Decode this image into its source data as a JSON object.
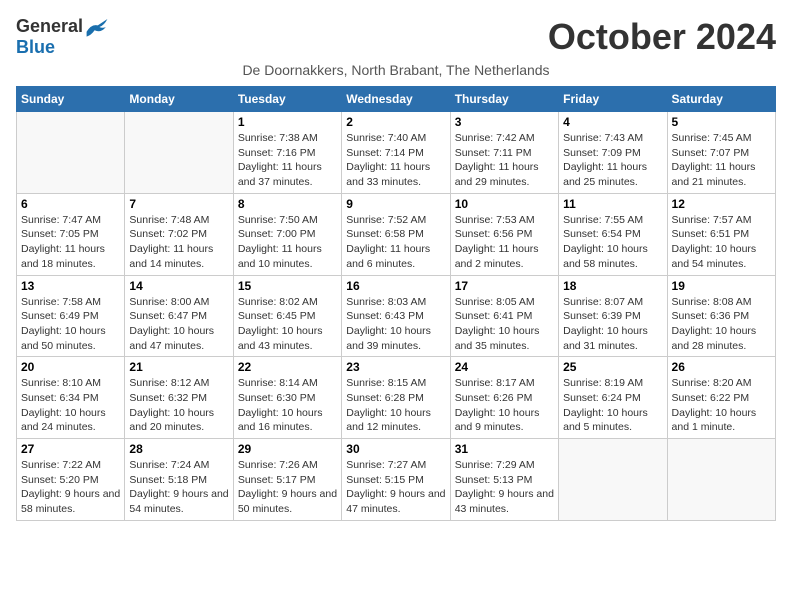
{
  "header": {
    "logo_general": "General",
    "logo_blue": "Blue",
    "month": "October 2024",
    "subtitle": "De Doornakkers, North Brabant, The Netherlands"
  },
  "days_of_week": [
    "Sunday",
    "Monday",
    "Tuesday",
    "Wednesday",
    "Thursday",
    "Friday",
    "Saturday"
  ],
  "weeks": [
    [
      {
        "day": "",
        "empty": true
      },
      {
        "day": "",
        "empty": true
      },
      {
        "day": "1",
        "sunrise": "7:38 AM",
        "sunset": "7:16 PM",
        "daylight": "11 hours and 37 minutes."
      },
      {
        "day": "2",
        "sunrise": "7:40 AM",
        "sunset": "7:14 PM",
        "daylight": "11 hours and 33 minutes."
      },
      {
        "day": "3",
        "sunrise": "7:42 AM",
        "sunset": "7:11 PM",
        "daylight": "11 hours and 29 minutes."
      },
      {
        "day": "4",
        "sunrise": "7:43 AM",
        "sunset": "7:09 PM",
        "daylight": "11 hours and 25 minutes."
      },
      {
        "day": "5",
        "sunrise": "7:45 AM",
        "sunset": "7:07 PM",
        "daylight": "11 hours and 21 minutes."
      }
    ],
    [
      {
        "day": "6",
        "sunrise": "7:47 AM",
        "sunset": "7:05 PM",
        "daylight": "11 hours and 18 minutes."
      },
      {
        "day": "7",
        "sunrise": "7:48 AM",
        "sunset": "7:02 PM",
        "daylight": "11 hours and 14 minutes."
      },
      {
        "day": "8",
        "sunrise": "7:50 AM",
        "sunset": "7:00 PM",
        "daylight": "11 hours and 10 minutes."
      },
      {
        "day": "9",
        "sunrise": "7:52 AM",
        "sunset": "6:58 PM",
        "daylight": "11 hours and 6 minutes."
      },
      {
        "day": "10",
        "sunrise": "7:53 AM",
        "sunset": "6:56 PM",
        "daylight": "11 hours and 2 minutes."
      },
      {
        "day": "11",
        "sunrise": "7:55 AM",
        "sunset": "6:54 PM",
        "daylight": "10 hours and 58 minutes."
      },
      {
        "day": "12",
        "sunrise": "7:57 AM",
        "sunset": "6:51 PM",
        "daylight": "10 hours and 54 minutes."
      }
    ],
    [
      {
        "day": "13",
        "sunrise": "7:58 AM",
        "sunset": "6:49 PM",
        "daylight": "10 hours and 50 minutes."
      },
      {
        "day": "14",
        "sunrise": "8:00 AM",
        "sunset": "6:47 PM",
        "daylight": "10 hours and 47 minutes."
      },
      {
        "day": "15",
        "sunrise": "8:02 AM",
        "sunset": "6:45 PM",
        "daylight": "10 hours and 43 minutes."
      },
      {
        "day": "16",
        "sunrise": "8:03 AM",
        "sunset": "6:43 PM",
        "daylight": "10 hours and 39 minutes."
      },
      {
        "day": "17",
        "sunrise": "8:05 AM",
        "sunset": "6:41 PM",
        "daylight": "10 hours and 35 minutes."
      },
      {
        "day": "18",
        "sunrise": "8:07 AM",
        "sunset": "6:39 PM",
        "daylight": "10 hours and 31 minutes."
      },
      {
        "day": "19",
        "sunrise": "8:08 AM",
        "sunset": "6:36 PM",
        "daylight": "10 hours and 28 minutes."
      }
    ],
    [
      {
        "day": "20",
        "sunrise": "8:10 AM",
        "sunset": "6:34 PM",
        "daylight": "10 hours and 24 minutes."
      },
      {
        "day": "21",
        "sunrise": "8:12 AM",
        "sunset": "6:32 PM",
        "daylight": "10 hours and 20 minutes."
      },
      {
        "day": "22",
        "sunrise": "8:14 AM",
        "sunset": "6:30 PM",
        "daylight": "10 hours and 16 minutes."
      },
      {
        "day": "23",
        "sunrise": "8:15 AM",
        "sunset": "6:28 PM",
        "daylight": "10 hours and 12 minutes."
      },
      {
        "day": "24",
        "sunrise": "8:17 AM",
        "sunset": "6:26 PM",
        "daylight": "10 hours and 9 minutes."
      },
      {
        "day": "25",
        "sunrise": "8:19 AM",
        "sunset": "6:24 PM",
        "daylight": "10 hours and 5 minutes."
      },
      {
        "day": "26",
        "sunrise": "8:20 AM",
        "sunset": "6:22 PM",
        "daylight": "10 hours and 1 minute."
      }
    ],
    [
      {
        "day": "27",
        "sunrise": "7:22 AM",
        "sunset": "5:20 PM",
        "daylight": "9 hours and 58 minutes."
      },
      {
        "day": "28",
        "sunrise": "7:24 AM",
        "sunset": "5:18 PM",
        "daylight": "9 hours and 54 minutes."
      },
      {
        "day": "29",
        "sunrise": "7:26 AM",
        "sunset": "5:17 PM",
        "daylight": "9 hours and 50 minutes."
      },
      {
        "day": "30",
        "sunrise": "7:27 AM",
        "sunset": "5:15 PM",
        "daylight": "9 hours and 47 minutes."
      },
      {
        "day": "31",
        "sunrise": "7:29 AM",
        "sunset": "5:13 PM",
        "daylight": "9 hours and 43 minutes."
      },
      {
        "day": "",
        "empty": true
      },
      {
        "day": "",
        "empty": true
      }
    ]
  ]
}
